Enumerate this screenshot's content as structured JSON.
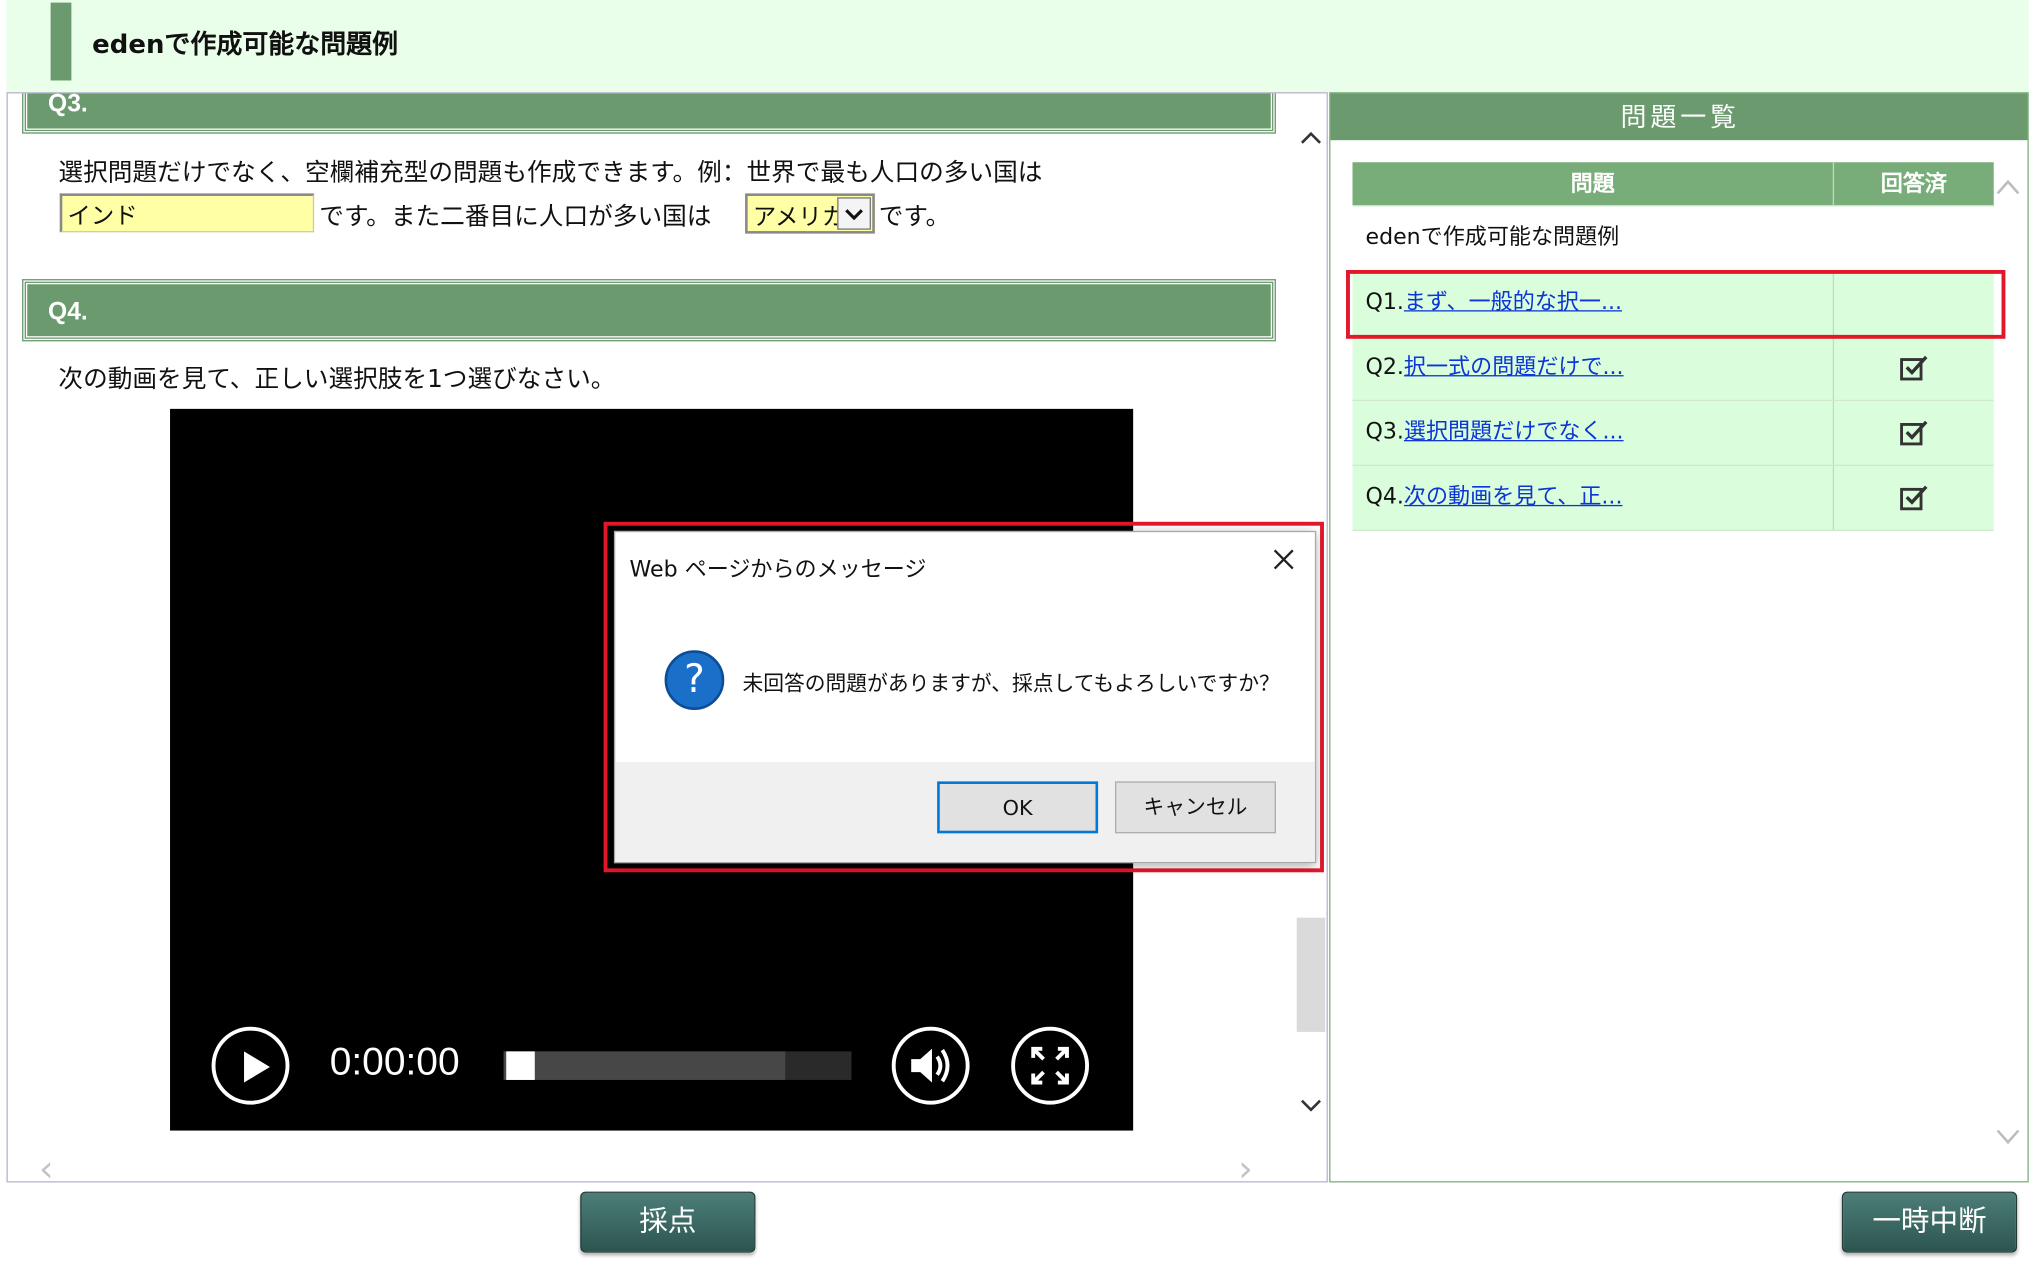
{
  "header": {
    "title": "edenで作成可能な問題例"
  },
  "q3": {
    "heading": "Q3.",
    "line1": "選択問題だけでなく、空欄補充型の問題も作成できます。例：世界で最も人口の多い国は",
    "input_value": "インド",
    "line2_mid": "です。また二番目に人口が多い国は",
    "select_value": "アメリカ",
    "line2_end": "です。"
  },
  "q4": {
    "heading": "Q4.",
    "text": "次の動画を見て、正しい選択肢を1つ選びなさい。"
  },
  "video": {
    "time": "0:00:00",
    "progress": 0.0,
    "buffered": 0.81,
    "icons": [
      "play-icon",
      "volume-icon",
      "fullscreen-icon"
    ]
  },
  "panel": {
    "title": "問題一覧",
    "col_question": "問題",
    "col_answered": "回答済",
    "title_row": "edenで作成可能な問題例",
    "items": [
      {
        "prefix": "Q1.",
        "link": "まず、一般的な択一...",
        "answered": false
      },
      {
        "prefix": "Q2.",
        "link": "択一式の問題だけで...",
        "answered": true
      },
      {
        "prefix": "Q3.",
        "link": "選択問題だけでなく...",
        "answered": true
      },
      {
        "prefix": "Q4.",
        "link": "次の動画を見て、正...",
        "answered": true
      }
    ]
  },
  "dialog": {
    "title": "Web ページからのメッセージ",
    "message": "未回答の問題がありますが、採点してもよろしいですか？",
    "ok": "OK",
    "cancel": "キャンセル",
    "icon": "question-icon"
  },
  "buttons": {
    "grade": "採点",
    "pause": "一時中断"
  },
  "colors": {
    "accent_green": "#6a9a6d",
    "highlight_red": "#e2182a",
    "link_blue": "#0b35d6",
    "dark_button": "#2d5550"
  }
}
